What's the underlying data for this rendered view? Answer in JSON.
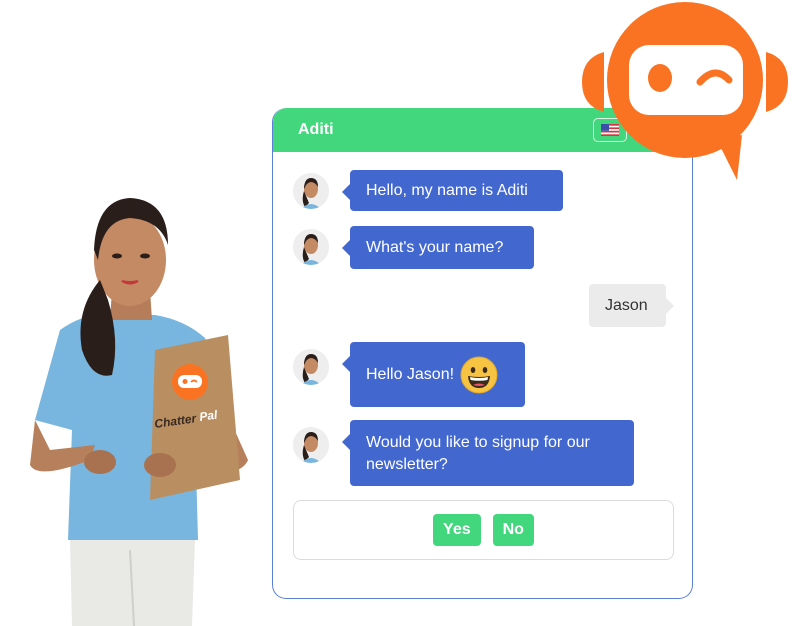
{
  "chat": {
    "title": "Aditi",
    "language_flag": "us-flag-icon",
    "messages": [
      {
        "sender": "bot",
        "text": "Hello, my name is Aditi"
      },
      {
        "sender": "bot",
        "text": "What's your name?"
      },
      {
        "sender": "user",
        "text": "Jason"
      },
      {
        "sender": "bot",
        "text": "Hello Jason!",
        "emoji": "grinning-face-emoji"
      },
      {
        "sender": "bot",
        "text": "Would you like to signup for our newsletter?"
      }
    ],
    "choices": [
      "Yes",
      "No"
    ]
  },
  "branding": {
    "clipboard_logo_text_1": "Chatter",
    "clipboard_logo_text_2": "Pal",
    "logo_icon": "robot-chat-bubble-icon"
  },
  "colors": {
    "header_green": "#42d77d",
    "bot_bubble_blue": "#4267cf",
    "user_bubble_gray": "#ebebeb",
    "brand_orange": "#f97322",
    "widget_border": "#5b7fd6"
  }
}
